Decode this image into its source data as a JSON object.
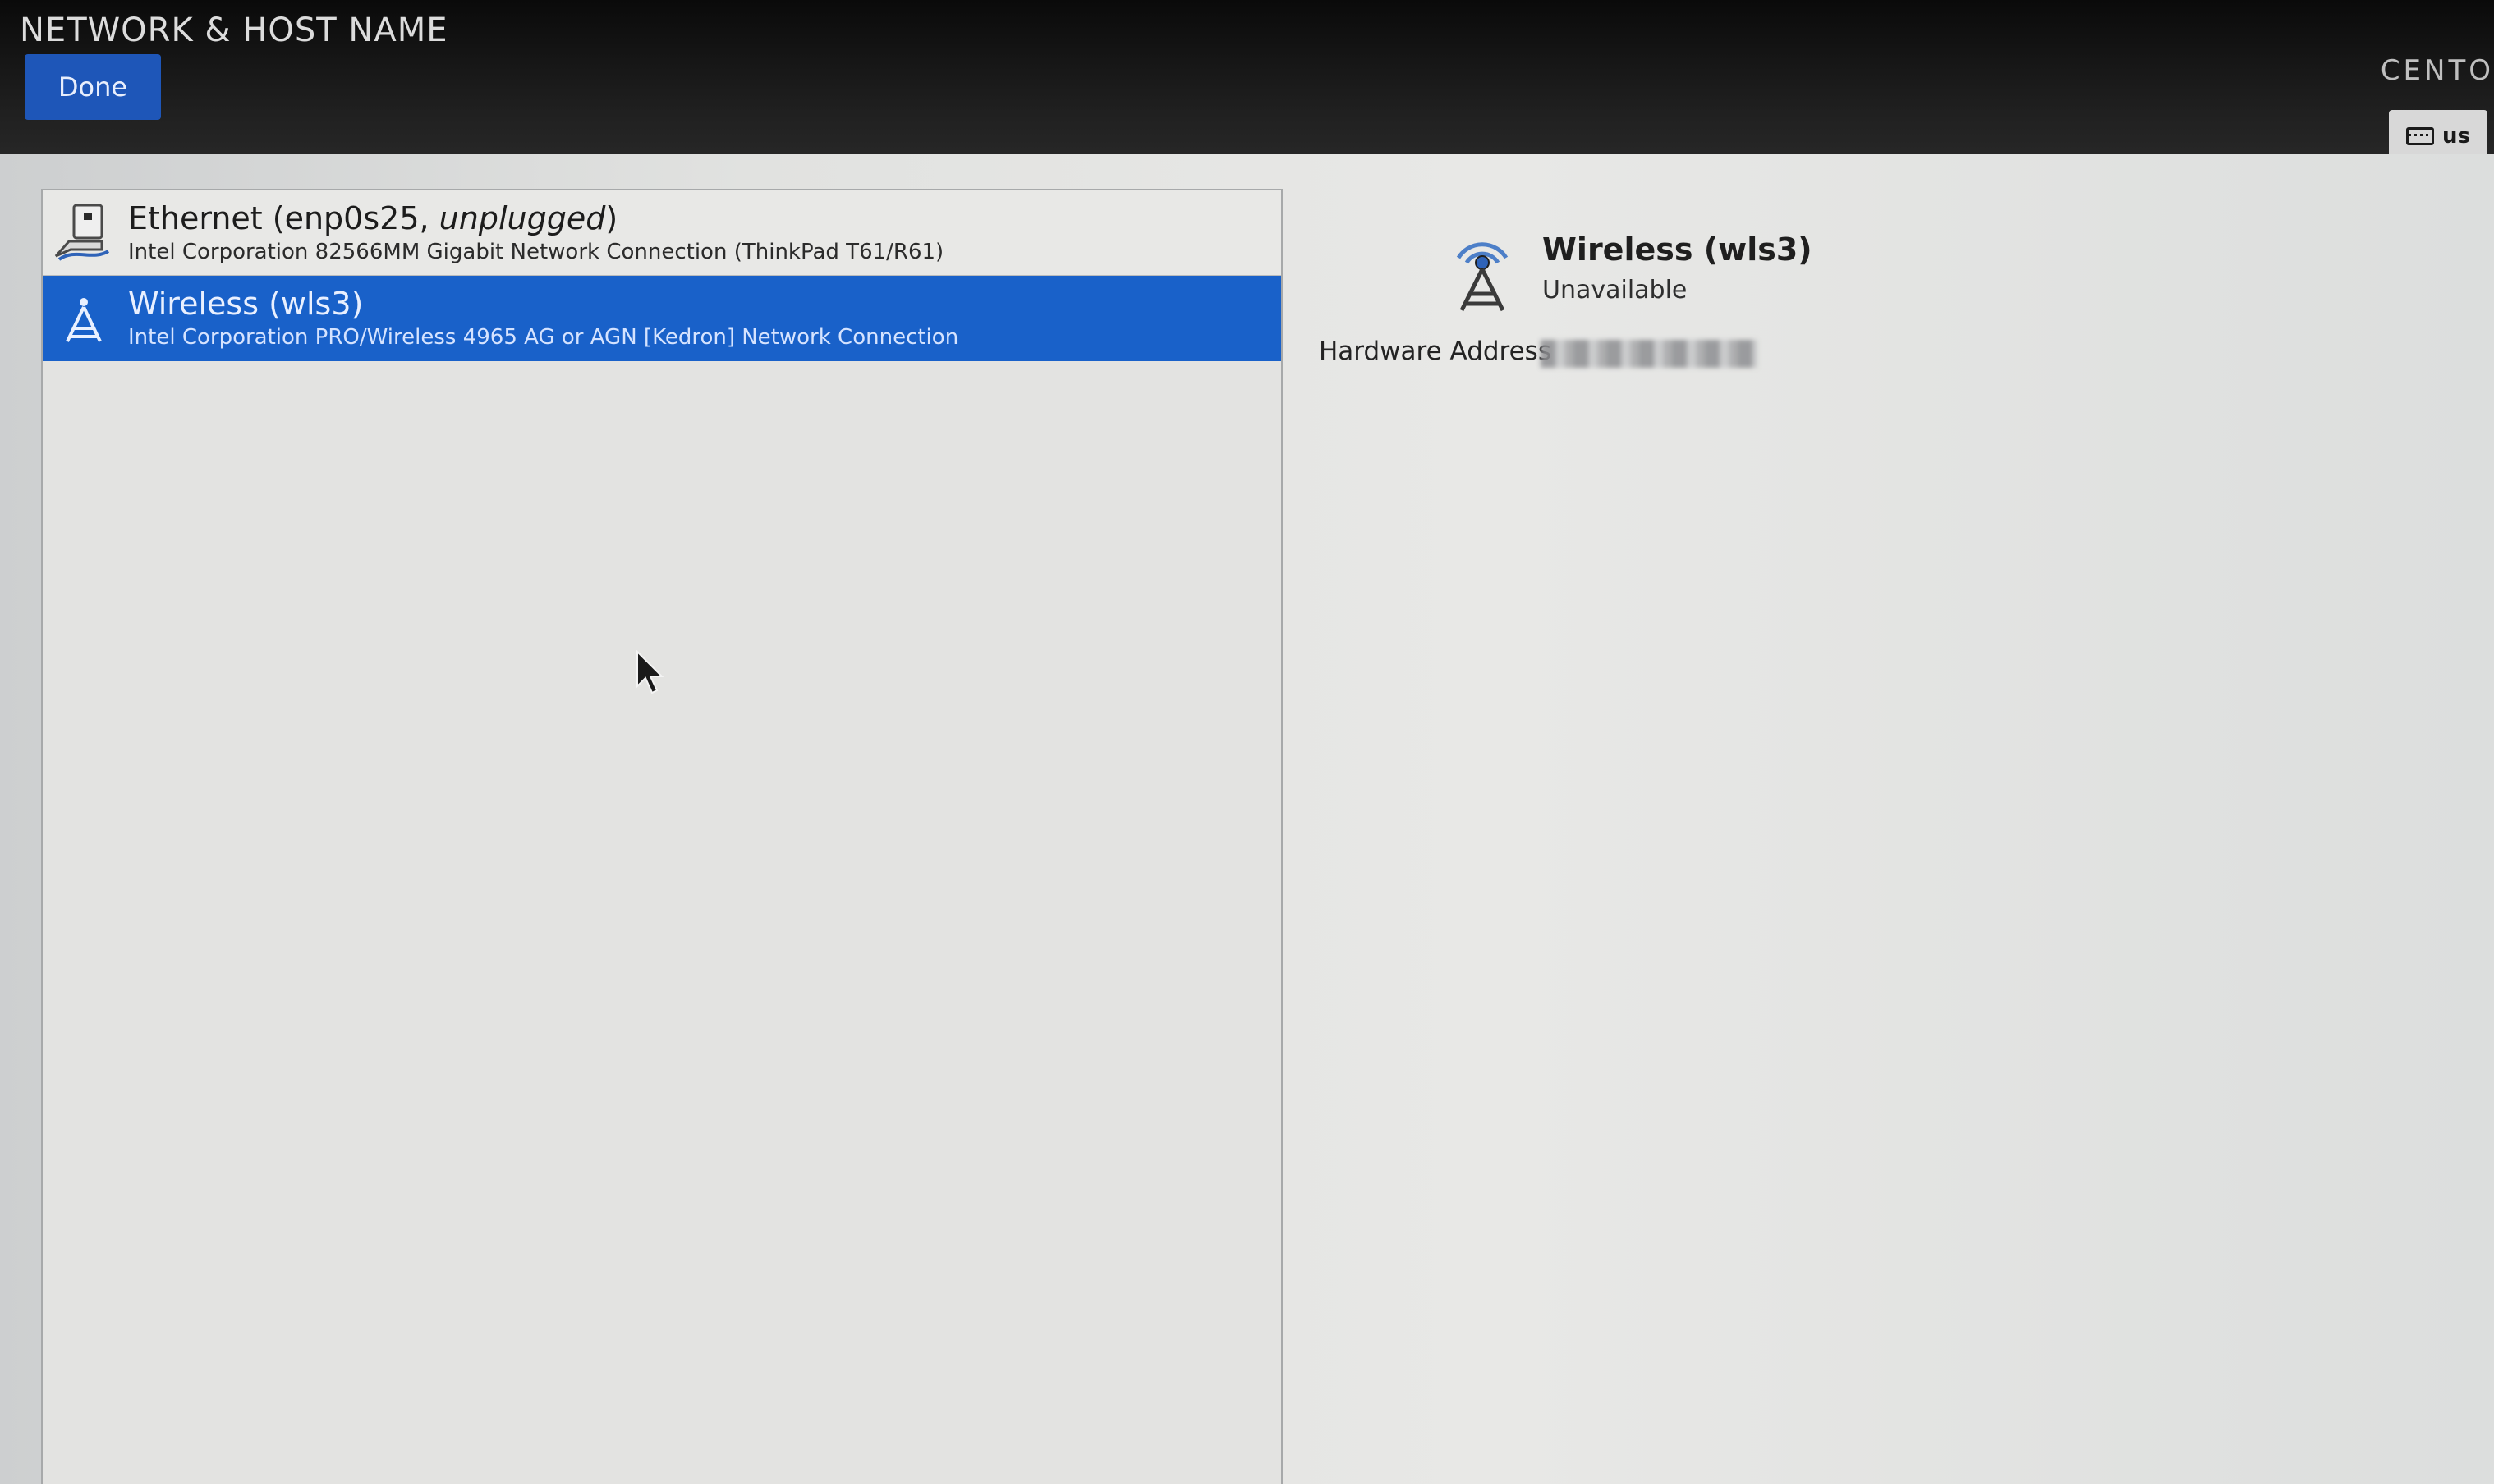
{
  "header": {
    "title": "NETWORK & HOST NAME",
    "done_label": "Done",
    "product": "CENTO",
    "keyboard_layout": "us"
  },
  "devices": [
    {
      "name_prefix": "Ethernet (enp0s25, ",
      "name_state": "unplugged",
      "name_suffix": ")",
      "description": "Intel Corporation 82566MM Gigabit Network Connection (ThinkPad T61/R61)",
      "icon": "ethernet-icon",
      "selected": false
    },
    {
      "name": "Wireless (wls3)",
      "description": "Intel Corporation PRO/Wireless 4965 AG or AGN [Kedron] Network Connection",
      "icon": "wireless-tower-icon",
      "selected": true
    }
  ],
  "detail": {
    "name": "Wireless (wls3)",
    "status": "Unavailable",
    "hardware_address_label": "Hardware Address",
    "icon": "wireless-tower-icon"
  },
  "colors": {
    "selection": "#1961c9",
    "done_button": "#1e56b8"
  }
}
